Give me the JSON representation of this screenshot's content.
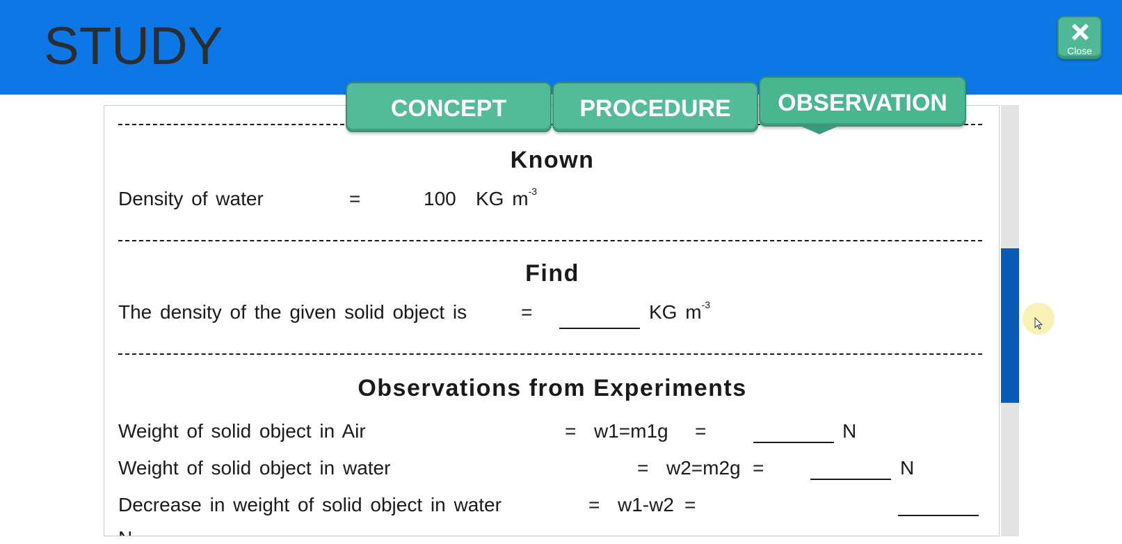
{
  "app": {
    "title": "STUDY",
    "close_label": "Close",
    "accent_color": "#0d78e5",
    "button_color": "#54bb99"
  },
  "tabs": [
    {
      "label": "CONCEPT",
      "active": false
    },
    {
      "label": "PROCEDURE",
      "active": false
    },
    {
      "label": "OBSERVATION",
      "active": true
    }
  ],
  "known": {
    "title": "Known",
    "row": {
      "label": "Density of water",
      "eq": "=",
      "value": "100",
      "unit": "KG  m",
      "unit_sup": "-3"
    }
  },
  "find": {
    "title": "Find",
    "row": {
      "label": "The density of the given solid object is",
      "eq": "=",
      "blank": "________",
      "unit": "KG  m",
      "unit_sup": "-3"
    }
  },
  "observations": {
    "title": "Observations from Experiments",
    "rows": [
      {
        "label": "Weight of solid object in Air",
        "eq1": "=",
        "formula": "w1=m1g",
        "eq2": "=",
        "unit": "N"
      },
      {
        "label": "Weight of solid object in water",
        "eq1": "=",
        "formula": "w2=m2g",
        "eq2": "=",
        "unit": "N"
      },
      {
        "label": "Decrease in weight of solid object in water",
        "eq1": "=",
        "formula": "w1-w2",
        "eq2": "=",
        "unit": "N"
      }
    ]
  },
  "scroll": {
    "position_fraction": 0.33
  }
}
